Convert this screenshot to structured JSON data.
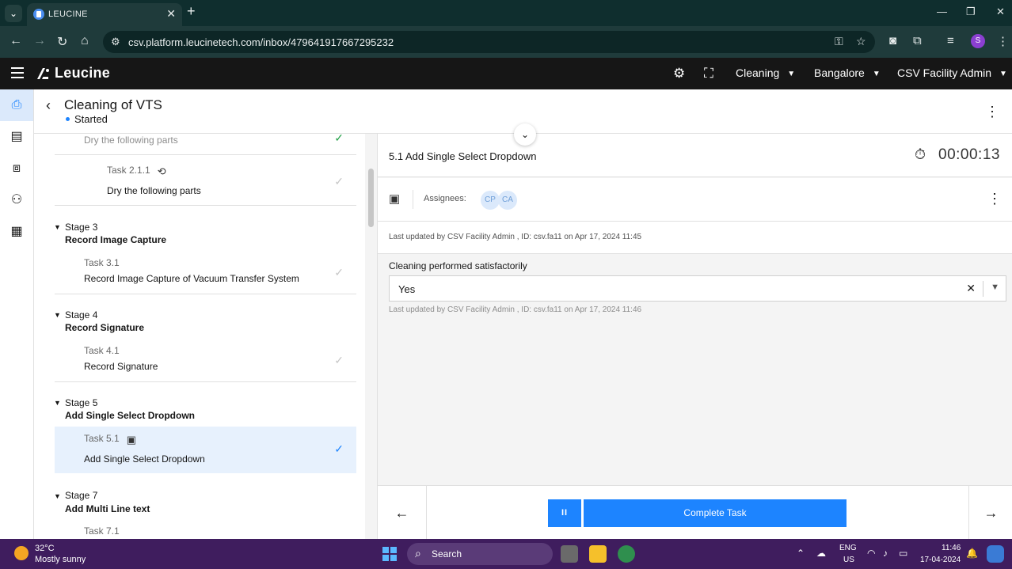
{
  "browser": {
    "tab_title": "LEUCINE",
    "url": "csv.platform.leucinetech.com/inbox/479641917667295232",
    "profile_initial": "S"
  },
  "app": {
    "brand": "Leucine",
    "use_case": "Cleaning",
    "facility": "Bangalore",
    "user": "CSV Facility Admin"
  },
  "page": {
    "checklist_name": "Cleaning of VTS",
    "status": "Started"
  },
  "task_list": {
    "partial_top_task": {
      "name": "Dry the following parts"
    },
    "task_2_1_1": {
      "number": "Task 2.1.1",
      "name": "Dry the following parts"
    },
    "stages": [
      {
        "number": "Stage 3",
        "name": "Record Image Capture",
        "task_number": "Task 3.1",
        "task_name": "Record Image Capture of Vacuum Transfer System"
      },
      {
        "number": "Stage 4",
        "name": "Record Signature",
        "task_number": "Task 4.1",
        "task_name": "Record Signature"
      },
      {
        "number": "Stage 5",
        "name": "Add Single Select Dropdown",
        "task_number": "Task 5.1",
        "task_name": "Add Single Select Dropdown"
      },
      {
        "number": "Stage 7",
        "name": "Add Multi Line text",
        "task_number": "Task 7.1"
      }
    ]
  },
  "task_panel": {
    "title": "5.1 Add Single Select Dropdown",
    "timer": "00:00:13",
    "assignees_label": "Assignees:",
    "assignees": [
      "CP",
      "CA"
    ],
    "last_updated": "Last updated by CSV Facility Admin , ID: csv.fa11 on Apr 17, 2024 11:45",
    "parameter_label": "Cleaning performed satisfactorily",
    "parameter_value": "Yes",
    "parameter_updated": "Last updated by CSV Facility Admin , ID: csv.fa11 on Apr 17, 2024 11:46",
    "complete_label": "Complete Task",
    "pause_label": "II"
  },
  "taskbar": {
    "temperature": "32°C",
    "weather": "Mostly sunny",
    "search_label": "Search",
    "lang_line1": "ENG",
    "lang_line2": "US",
    "time": "11:46",
    "date": "17-04-2024"
  },
  "colors": {
    "accent": "#1d84ff",
    "header_bg": "#161616",
    "done_green": "#24a148",
    "taskbar_bg": "#3f1d5e"
  }
}
